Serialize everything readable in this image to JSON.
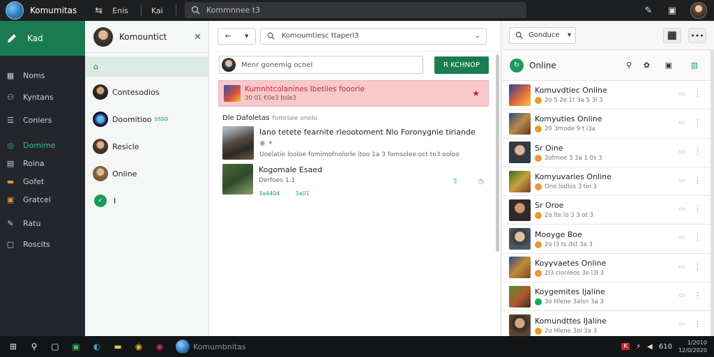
{
  "app": {
    "title": "Komumitas"
  },
  "titlebar": {
    "item_swap": "Enis",
    "item_km": "Kai",
    "search_text": "Kommnnee t3"
  },
  "nav": {
    "home": "Kad",
    "items": [
      "Noms",
      "Kyntans",
      "Conlers",
      "Domime",
      "Roina",
      "Gofet",
      "Gratcel",
      "Ratu",
      "Roscits"
    ]
  },
  "contacts": {
    "title": "Komountict",
    "online_label": "Online",
    "rows": [
      {
        "name": "Contesodios",
        "badge": ""
      },
      {
        "name": "Doomitioo",
        "badge": "ssso"
      },
      {
        "name": "Resicle",
        "badge": ""
      },
      {
        "name": "Online",
        "badge": ""
      },
      {
        "name": "I",
        "badge": ""
      }
    ]
  },
  "main": {
    "address": "Komoumtiesc ttaperl3",
    "compose_placeholder": "Menr gonemig ocnel",
    "post_button": "R KCHNOP",
    "alert": {
      "title": "Kumnhtcolanines Ibetiles fooorie",
      "meta": "30 01 €0e3 bsle3"
    },
    "section": {
      "title": "Dle Dafoletas",
      "sub": "fomrsee onelo"
    },
    "items": [
      {
        "title": "Iano tetete fearnite rleootoment Nlo Foronygnie tiriande",
        "sub": "Uoelatie looloe fomimofnolorle itoo 1a 3 fomsolee oct to3 ooloo"
      },
      {
        "title": "Kogomale Esaed",
        "sub": "Derfoes 1.1",
        "stat1": "3a4404",
        "stat2": "3a01"
      }
    ]
  },
  "right": {
    "dropdown": "Gonduce",
    "header": "Online",
    "rows": [
      {
        "name": "Komuvdtiec Online",
        "meta": "2o 5 2e 1t 3a 5 3l 3"
      },
      {
        "name": "Komyuties Online",
        "meta": "20 3mode 9 t i3a"
      },
      {
        "name": "Sr Oine",
        "meta": "2ofmee 3 3a 1 0s 3"
      },
      {
        "name": "Komyuvaries Online",
        "meta": "Ono lodlos 3 tin 3"
      },
      {
        "name": "Sr Oroe",
        "meta": "2o lte lo 3 3 ot 3"
      },
      {
        "name": "Mooyge Boe",
        "meta": "2o l3 ts dst 3a 3"
      },
      {
        "name": "Koyyvaetes Online",
        "meta": "2l3 cionleos 3e l3l 3"
      },
      {
        "name": "Koygemites Ijaline",
        "meta": "3o Hlene 3alsn 3a 3"
      },
      {
        "name": "Komundttes IJaline",
        "meta": "2o Hlene 3ol 3a 3"
      }
    ]
  },
  "taskbar": {
    "app_label": "Komumbnitas",
    "tray_num": "610",
    "clock_time": "1/2010",
    "clock_date": "12/0/2020"
  }
}
